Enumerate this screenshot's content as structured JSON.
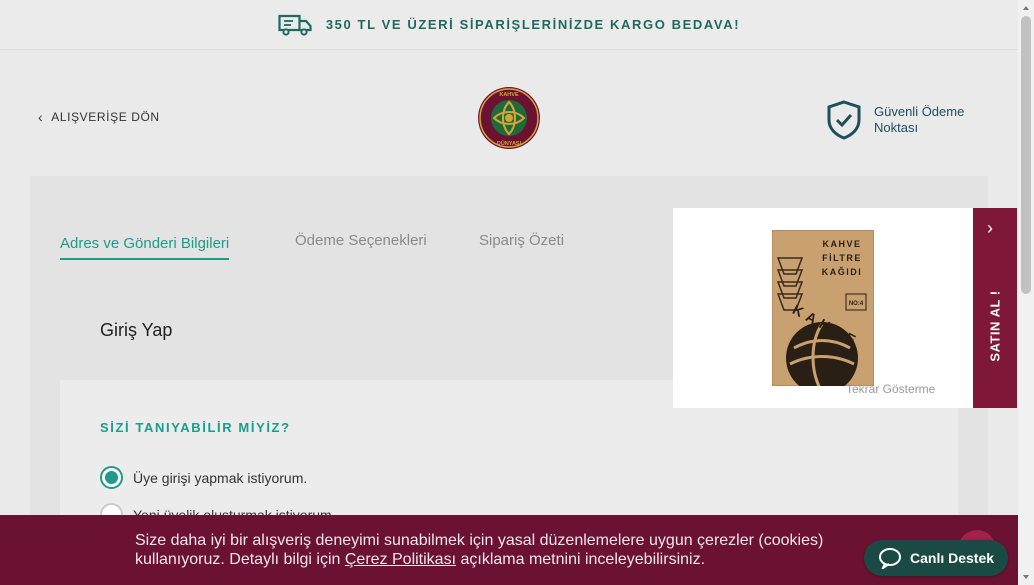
{
  "topbar": {
    "message": "350 TL VE ÜZERİ SİPARİŞLERİNİZDE KARGO BEDAVA!",
    "icon": "truck-icon"
  },
  "header": {
    "back_label": "ALIŞVERİŞE DÖN",
    "logo_text": "KAHVE DÜNYASI",
    "secure_label": "Güvenli Ödeme Noktası"
  },
  "tabs": [
    {
      "label": "Adres ve Gönderi  Bilgileri",
      "active": true
    },
    {
      "label": "Ödeme Seçenekleri",
      "active": false
    },
    {
      "label": "Sipariş Özeti",
      "active": false
    }
  ],
  "login": {
    "title": "Giriş Yap",
    "question": "SİZİ TANIYABİLİR MİYİZ?",
    "options": [
      {
        "label": "Üye girişi yapmak istiyorum.",
        "checked": true
      },
      {
        "label": "Yeni üyelik oluşturmak istiyorum.",
        "checked": false
      }
    ]
  },
  "popup": {
    "product_lines": [
      "KAHVE",
      "FİLTRE",
      "KAĞIDI"
    ],
    "product_badge": "NO:4",
    "product_brand": "KAHVE",
    "dismiss_label": "Tekrar Gösterme",
    "buy_label": "SATIN AL !"
  },
  "cookie": {
    "text_before": "Size daha iyi bir alışveriş deneyimi sunabilmek için yasal düzenlemelere uygun çerezler (cookies) kullanıyoruz. Detaylı bilgi için ",
    "link_label": "Çerez Politikası",
    "text_after": " açıklama metnini inceleyebilirsiniz."
  },
  "support": {
    "label": "Canlı Destek"
  },
  "colors": {
    "brand_green": "#1e9b8a",
    "banner_text": "#1e6b5e",
    "brand_maroon": "#7e1738",
    "cookie_bg": "#6b1232",
    "support_bg": "#1b4a44"
  }
}
